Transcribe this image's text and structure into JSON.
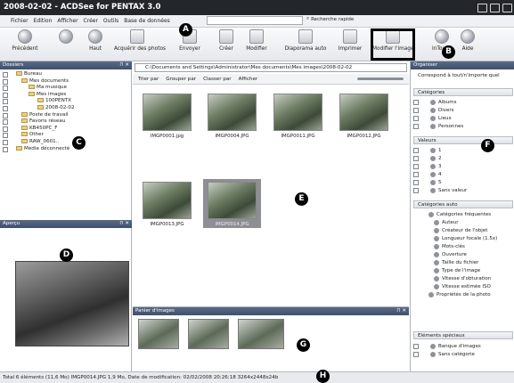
{
  "window": {
    "title": "2008-02-02 - ACDSee for PENTAX 3.0"
  },
  "menu": {
    "items": [
      "Fichier",
      "Edition",
      "Afficher",
      "Créer",
      "Outils",
      "Base de données"
    ],
    "search_label": "Recherche rapide"
  },
  "toolbar": {
    "buttons": [
      "Précédent",
      "Haut",
      "Acquérir des photos",
      "Envoyer",
      "Créer",
      "Modifier",
      "Diaporama auto",
      "Imprimer",
      "Modifier l'image",
      "InTouch",
      "Aide"
    ]
  },
  "folders": {
    "title": "Dossiers",
    "items": [
      "Bureau",
      "Mes documents",
      "Ma musique",
      "Mes images",
      "100PENTX",
      "2008-02-02",
      "Poste de travail",
      "Favoris réseau",
      "KB450PC_F",
      "Other",
      "RAW_0601..",
      "Média déconnecté"
    ]
  },
  "preview": {
    "title": "Aperçu"
  },
  "main": {
    "path": "C:\\Documents and Settings\\Administrator\\Mes documents\\Mes images\\2008-02-02",
    "view_buttons": [
      "Trier par",
      "Grouper par",
      "Classer par",
      "Afficher"
    ],
    "thumbnails": [
      "IMGP0001.jpg",
      "IMGP0004.JPG",
      "IMGP0011.JPG",
      "IMGP0012.JPG",
      "IMGP0013.JPG",
      "IMGP0014.JPG"
    ]
  },
  "basket": {
    "title": "Panier d'images"
  },
  "organizer": {
    "title": "Organiser",
    "filter": "Correspond à tout/n'importe quel",
    "categories_title": "Catégories",
    "categories": [
      "Albums",
      "Divers",
      "Lieux",
      "Personnes"
    ],
    "ratings_title": "Valeurs",
    "ratings": [
      "1",
      "2",
      "3",
      "4",
      "5",
      "Sans valeur"
    ],
    "auto_title": "Catégories auto",
    "auto_items": [
      "Catégories fréquentes",
      "Auteur",
      "Créateur de l'objet",
      "Longueur focale (1.5x)",
      "Mots-clés",
      "Ouverture",
      "Taille du fichier",
      "Type de l'image",
      "Vitesse d'obturation",
      "Vitesse estimée ISO",
      "Propriétés de la photo"
    ],
    "special_title": "Eléments spéciaux",
    "special_items": [
      "Banque d'images",
      "Sans catégorie"
    ]
  },
  "status": {
    "text": "Total 6 éléments  (11,6 Mo)   IMGP0014.JPG   1,9 Mo, Date de modification: 02/02/2008 20:26:18   3264x2448x24b"
  },
  "callouts": [
    "A",
    "B",
    "C",
    "D",
    "E",
    "F",
    "G",
    "H"
  ]
}
